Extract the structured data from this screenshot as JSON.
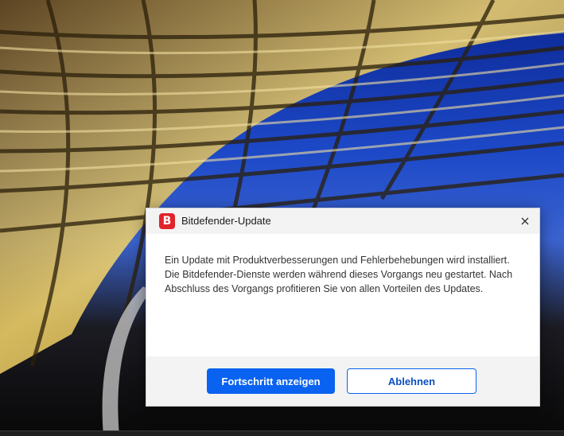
{
  "dialog": {
    "title": "Bitdefender-Update",
    "logo_letter": "B",
    "logo_color": "#e0242c",
    "close_icon": "close-icon",
    "message": "Ein Update mit Produktverbesserungen und Fehlerbehebungen wird installiert. Die Bitdefender-Dienste werden während dieses Vorgangs neu gestartet. Nach Abschluss des Vorgangs profitieren Sie von allen Vorteilen des Updates.",
    "primary_button": "Fortschritt anzeigen",
    "secondary_button": "Ablehnen",
    "accent_color": "#0a63f0"
  }
}
